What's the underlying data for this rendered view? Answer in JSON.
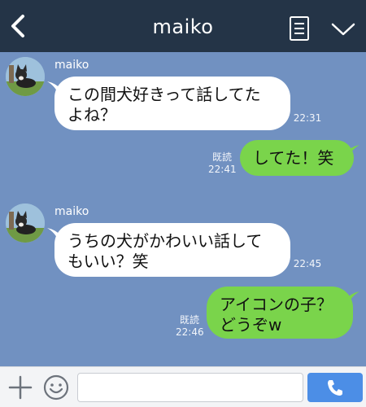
{
  "header": {
    "title": "maiko",
    "back_icon": "chevron-left-icon",
    "menu_icon": "note-list-icon",
    "dropdown_icon": "chevron-down-icon"
  },
  "messages": [
    {
      "direction": "in",
      "sender": "maiko",
      "lines": [
        "この間犬好きって話してた",
        "よね？"
      ],
      "time": "22:31"
    },
    {
      "direction": "out",
      "lines": [
        "してた！笑"
      ],
      "read_label": "既読",
      "time": "22:41"
    },
    {
      "direction": "in",
      "sender": "maiko",
      "lines": [
        "うちの犬がかわいい話して",
        "もいい？笑"
      ],
      "time": "22:45"
    },
    {
      "direction": "out",
      "lines": [
        "アイコンの子？",
        "どうぞw"
      ],
      "read_label": "既読",
      "time": "22:46"
    }
  ],
  "input_bar": {
    "plus_icon": "plus-icon",
    "emoji_icon": "smiley-icon",
    "message_value": "",
    "call_icon": "phone-icon"
  },
  "colors": {
    "chat_background": "#7191c1",
    "header_background": "#243447",
    "outgoing_bubble": "#7ad44b",
    "incoming_bubble": "#ffffff",
    "call_button": "#4c8ee6"
  }
}
